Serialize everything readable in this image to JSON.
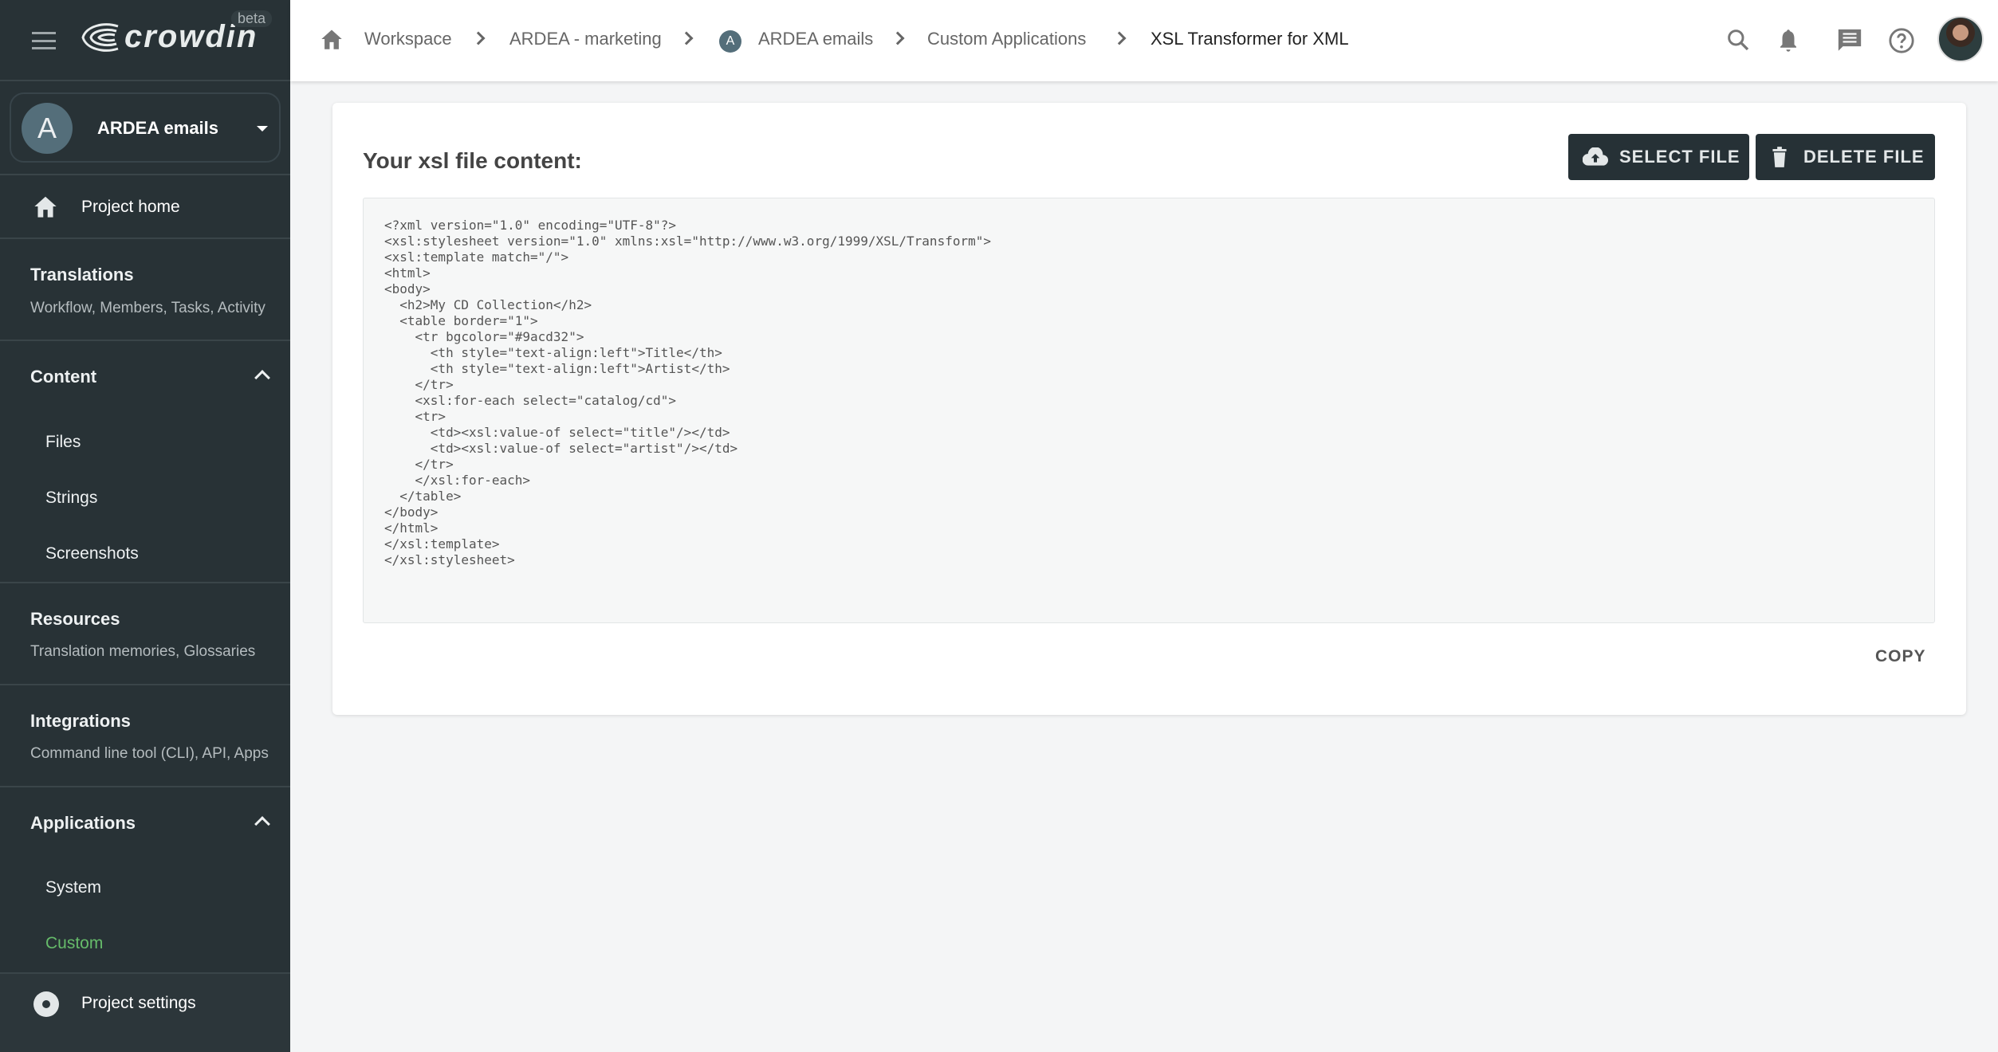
{
  "sidebar": {
    "logo_text": "crowdin",
    "beta_label": "beta",
    "project": {
      "initial": "A",
      "name": "ARDEA emails"
    },
    "project_home": "Project home",
    "sections": [
      {
        "title": "Translations",
        "subtitle": "Workflow, Members, Tasks, Activity"
      },
      {
        "title": "Content",
        "items": [
          "Files",
          "Strings",
          "Screenshots"
        ]
      },
      {
        "title": "Resources",
        "subtitle": "Translation memories, Glossaries"
      },
      {
        "title": "Integrations",
        "subtitle": "Command line tool (CLI), API, Apps"
      },
      {
        "title": "Applications",
        "items": [
          "System",
          "Custom"
        ]
      }
    ],
    "active_item": "Custom",
    "project_settings": "Project settings",
    "accent_color": "#66bb6a"
  },
  "header": {
    "breadcrumb": [
      "Workspace",
      "ARDEA - marketing",
      "ARDEA emails",
      "Custom Applications",
      "XSL Transformer for XML"
    ],
    "breadcrumb_project_initial": "A",
    "icons": [
      "search-icon",
      "bell-icon",
      "chat-icon",
      "help-icon",
      "avatar"
    ]
  },
  "main": {
    "title": "Your xsl file content:",
    "select_file": "SELECT FILE",
    "delete_file": "DELETE FILE",
    "code": "<?xml version=\"1.0\" encoding=\"UTF-8\"?>\n<xsl:stylesheet version=\"1.0\" xmlns:xsl=\"http://www.w3.org/1999/XSL/Transform\">\n<xsl:template match=\"/\">\n<html>\n<body>\n  <h2>My CD Collection</h2>\n  <table border=\"1\">\n    <tr bgcolor=\"#9acd32\">\n      <th style=\"text-align:left\">Title</th>\n      <th style=\"text-align:left\">Artist</th>\n    </tr>\n    <xsl:for-each select=\"catalog/cd\">\n    <tr>\n      <td><xsl:value-of select=\"title\"/></td>\n      <td><xsl:value-of select=\"artist\"/></td>\n    </tr>\n    </xsl:for-each>\n  </table>\n</body>\n</html>\n</xsl:template>\n</xsl:stylesheet>",
    "copy": "COPY"
  }
}
